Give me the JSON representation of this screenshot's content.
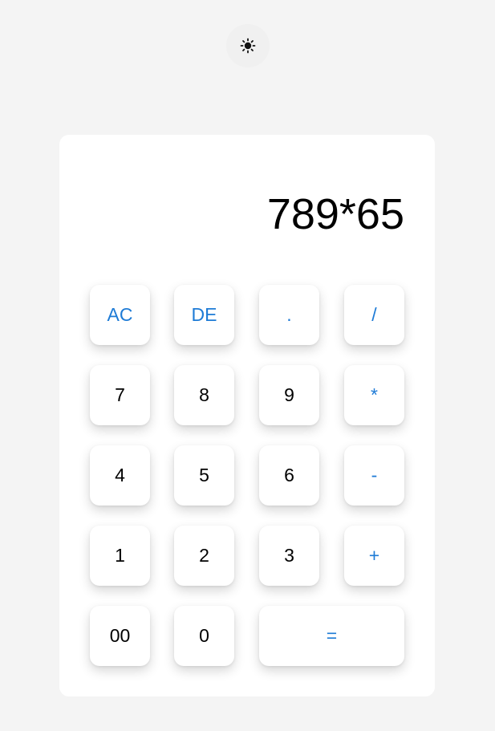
{
  "theme_toggle": {
    "icon": "sun-icon"
  },
  "display": {
    "expression": "789*65"
  },
  "keys": {
    "ac": "AC",
    "de": "DE",
    "dot": ".",
    "divide": "/",
    "seven": "7",
    "eight": "8",
    "nine": "9",
    "multiply": "*",
    "four": "4",
    "five": "5",
    "six": "6",
    "minus": "-",
    "one": "1",
    "two": "2",
    "three": "3",
    "plus": "+",
    "double_zero": "00",
    "zero": "0",
    "equals": "="
  },
  "colors": {
    "background": "#f4f4f4",
    "panel": "#ffffff",
    "accent": "#1e7bd6",
    "text": "#000000"
  }
}
